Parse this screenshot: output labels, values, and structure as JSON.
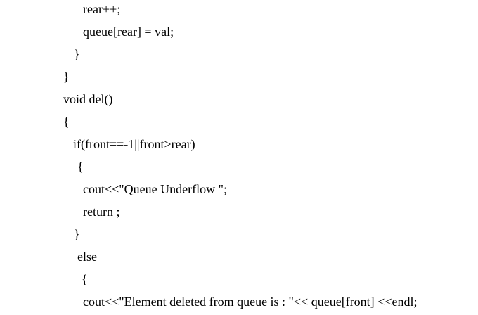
{
  "document": {
    "lines": [
      "rear++;",
      "queue[rear] = val;",
      "}",
      "}",
      "void del()",
      "{",
      "if(front==-1||front>rear)",
      "{",
      "cout<<\"Queue Underflow \";",
      "return ;",
      "}",
      "else",
      "{",
      "cout<<\"Element deleted from queue is : \"<< queue[front] <<endl;"
    ]
  }
}
